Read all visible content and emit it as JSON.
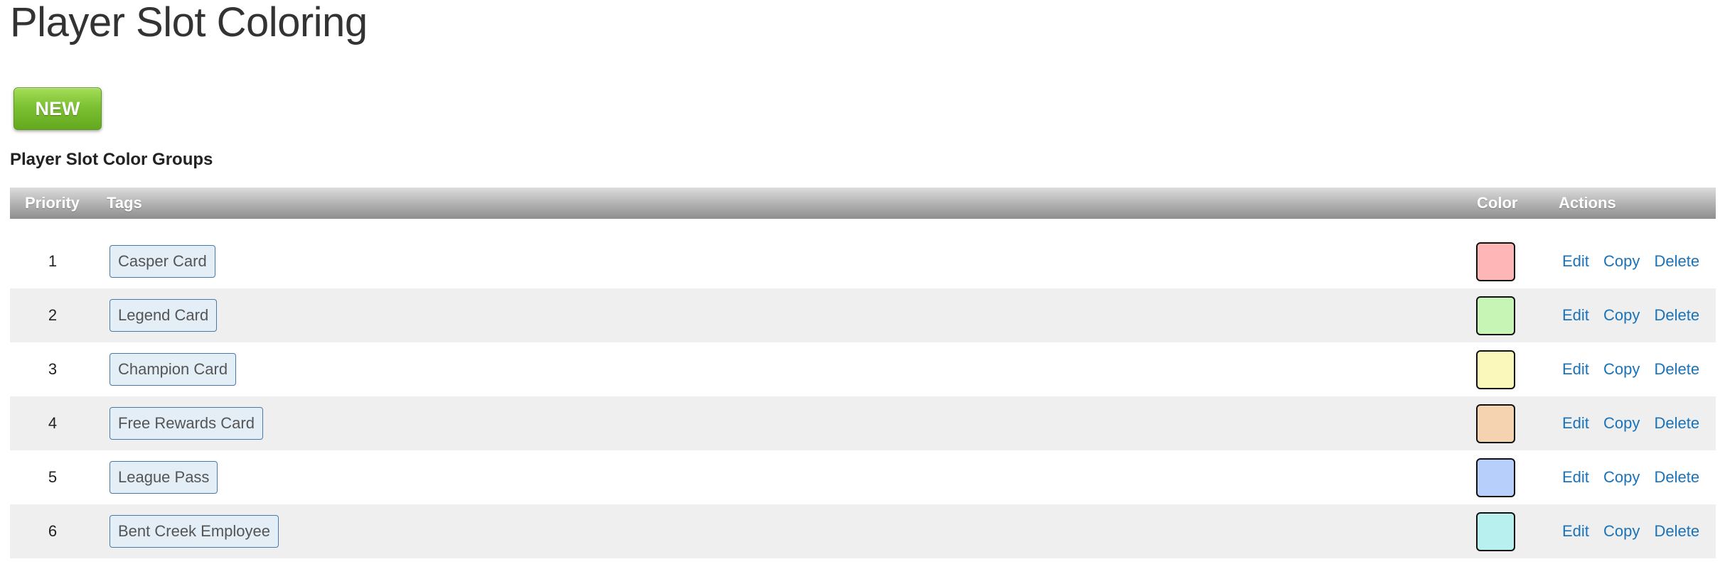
{
  "page": {
    "title": "Player Slot Coloring",
    "new_button_label": "NEW",
    "section_title": "Player Slot Color Groups"
  },
  "table": {
    "headers": {
      "priority": "Priority",
      "tags": "Tags",
      "color": "Color",
      "actions": "Actions"
    },
    "action_labels": {
      "edit": "Edit",
      "copy": "Copy",
      "delete": "Delete"
    },
    "rows": [
      {
        "priority": "1",
        "tag": "Casper Card",
        "color": "#ffb6b6"
      },
      {
        "priority": "2",
        "tag": "Legend Card",
        "color": "#c7f5b6"
      },
      {
        "priority": "3",
        "tag": "Champion Card",
        "color": "#fbf8bb"
      },
      {
        "priority": "4",
        "tag": "Free Rewards Card",
        "color": "#f5d3b0"
      },
      {
        "priority": "5",
        "tag": "League Pass",
        "color": "#b7cffb"
      },
      {
        "priority": "6",
        "tag": "Bent Creek Employee",
        "color": "#b7f0ee"
      }
    ]
  },
  "colors": {
    "new_button": "#7cc132",
    "link": "#1a73b8",
    "tag_border": "#4a79a8",
    "tag_bg": "#e4eef7"
  }
}
